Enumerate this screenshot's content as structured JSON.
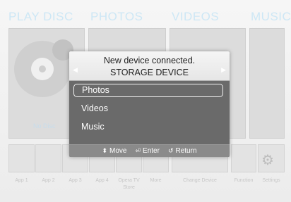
{
  "sections": [
    "PLAY DISC",
    "PHOTOS",
    "VIDEOS",
    "MUSIC"
  ],
  "disc": {
    "label": "No Disc"
  },
  "dialog": {
    "title": "New device connected.",
    "subtitle": "STORAGE DEVICE",
    "items": [
      {
        "label": "Photos",
        "selected": true
      },
      {
        "label": "Videos",
        "selected": false
      },
      {
        "label": "Music",
        "selected": false
      }
    ],
    "footer": {
      "move_icon": "⬍",
      "move_label": "Move",
      "enter_icon": "⏎",
      "enter_label": "Enter",
      "return_icon": "↺",
      "return_label": "Return"
    }
  },
  "apps": {
    "labels": [
      "App 1",
      "App 2",
      "App 3",
      "App 4",
      "Opera TV Store",
      "More",
      "Change Device",
      "Function",
      "Settings"
    ]
  }
}
